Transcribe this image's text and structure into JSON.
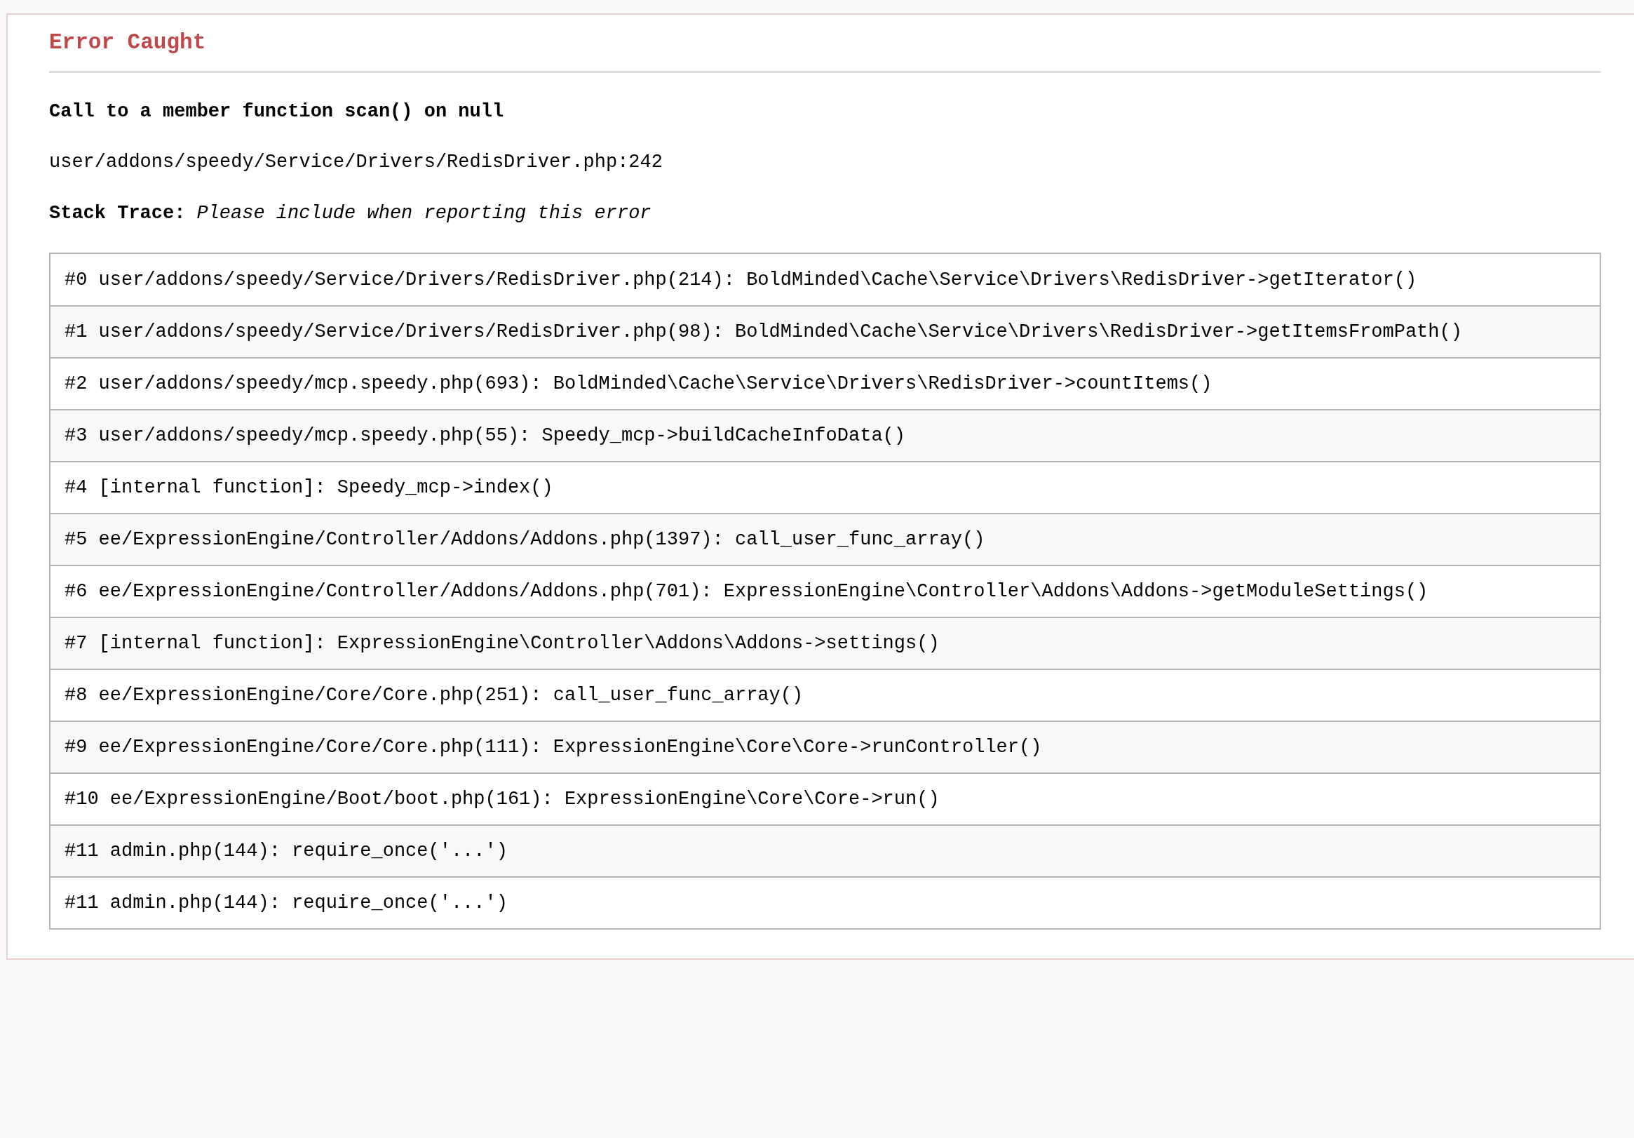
{
  "error": {
    "title": "Error Caught",
    "message": "Call to a member function scan() on null",
    "location": "user/addons/speedy/Service/Drivers/RedisDriver.php:242",
    "stack_trace_label": "Stack Trace:",
    "stack_trace_note": "Please include when reporting this error"
  },
  "stack_trace": [
    "#0 user/addons/speedy/Service/Drivers/RedisDriver.php(214): BoldMinded\\Cache\\Service\\Drivers\\RedisDriver->getIterator()",
    "#1 user/addons/speedy/Service/Drivers/RedisDriver.php(98): BoldMinded\\Cache\\Service\\Drivers\\RedisDriver->getItemsFromPath()",
    "#2 user/addons/speedy/mcp.speedy.php(693): BoldMinded\\Cache\\Service\\Drivers\\RedisDriver->countItems()",
    "#3 user/addons/speedy/mcp.speedy.php(55): Speedy_mcp->buildCacheInfoData()",
    "#4 [internal function]: Speedy_mcp->index()",
    "#5 ee/ExpressionEngine/Controller/Addons/Addons.php(1397): call_user_func_array()",
    "#6 ee/ExpressionEngine/Controller/Addons/Addons.php(701): ExpressionEngine\\Controller\\Addons\\Addons->getModuleSettings()",
    "#7 [internal function]: ExpressionEngine\\Controller\\Addons\\Addons->settings()",
    "#8 ee/ExpressionEngine/Core/Core.php(251): call_user_func_array()",
    "#9 ee/ExpressionEngine/Core/Core.php(111): ExpressionEngine\\Core\\Core->runController()",
    "#10 ee/ExpressionEngine/Boot/boot.php(161): ExpressionEngine\\Core\\Core->run()",
    "#11 admin.php(144): require_once('...')",
    "#11 admin.php(144): require_once('...')"
  ]
}
